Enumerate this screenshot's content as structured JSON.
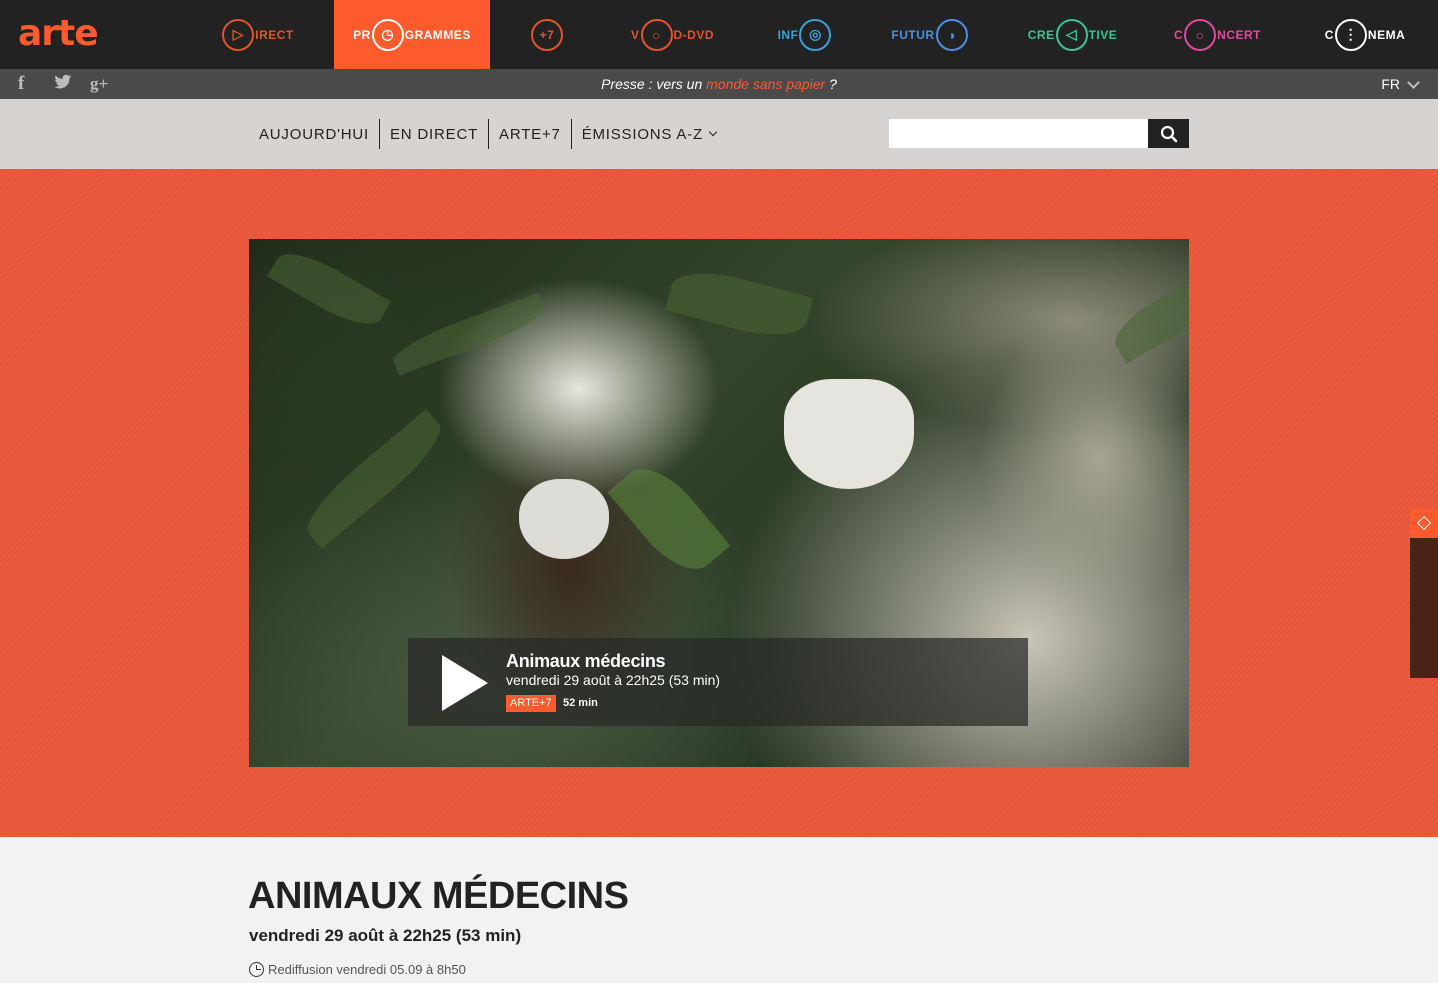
{
  "brand": {
    "logo_text": "arte",
    "accent": "#fd5a2e"
  },
  "top_nav": [
    {
      "name": "direct",
      "pre": "",
      "glyph": "▷",
      "post": "IRECT",
      "color": "#e3542c"
    },
    {
      "name": "programmes",
      "pre": "PR",
      "glyph": "◷",
      "post": "GRAMMES",
      "color": "#ffffff",
      "active": true
    },
    {
      "name": "plus7",
      "pre": "",
      "glyph": "+7",
      "post": "",
      "color": "#e3542c"
    },
    {
      "name": "vod-dvd",
      "pre": "V",
      "glyph": "○",
      "post": "D-DVD",
      "color": "#e3542c"
    },
    {
      "name": "info",
      "pre": "INF",
      "glyph": "◎",
      "post": "",
      "color": "#3aa1d8"
    },
    {
      "name": "future",
      "pre": "FUTUR",
      "glyph": "◑",
      "post": "",
      "color": "#4a90e2"
    },
    {
      "name": "creative",
      "pre": "CRE",
      "glyph": "◁",
      "post": "TIVE",
      "color": "#3cc29a"
    },
    {
      "name": "concert",
      "pre": "C",
      "glyph": "○",
      "post": "NCERT",
      "color": "#e04a9c"
    },
    {
      "name": "cinema",
      "pre": "C",
      "glyph": "⋮",
      "post": "NEMA",
      "color": "#ffffff"
    }
  ],
  "social": {
    "facebook": "f",
    "twitter": "t",
    "googleplus": "g+"
  },
  "press": {
    "prefix": "Presse : vers un ",
    "link": "monde sans papier",
    "suffix": " ?"
  },
  "language": "FR",
  "subnav": [
    {
      "label": "AUJOURD'HUI"
    },
    {
      "label": "EN DIRECT"
    },
    {
      "label": "ARTE+7"
    },
    {
      "label": "ÉMISSIONS A-Z",
      "dropdown": true
    }
  ],
  "search": {
    "placeholder": ""
  },
  "player": {
    "title": "Animaux médecins",
    "datetime": "vendredi 29 août à 22h25 (53 min)",
    "badge": "ARTE+7",
    "badge_duration": "52 min"
  },
  "program": {
    "title": "ANIMAUX MÉDECINS",
    "datetime": "vendredi 29 août à 22h25 (53 min)",
    "rerun": "Rediffusion vendredi 05.09 à 8h50"
  }
}
